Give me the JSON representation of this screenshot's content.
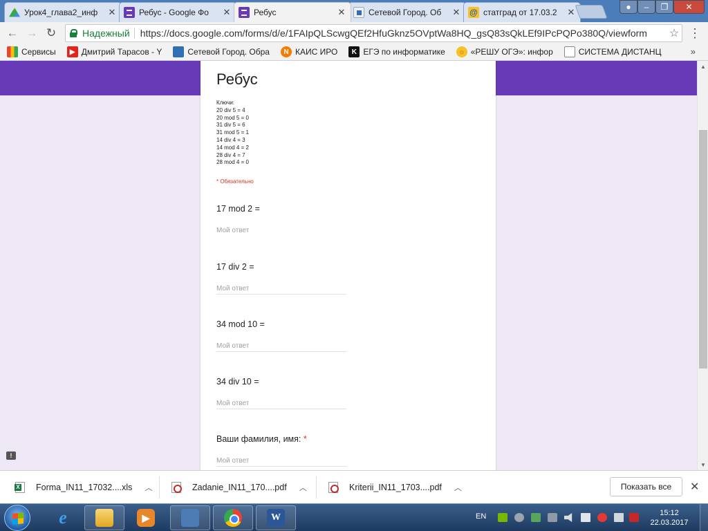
{
  "tabs": [
    {
      "title": "Урок4_глава2_инф",
      "favicon": "drive-icon",
      "active": false
    },
    {
      "title": "Ребус - Google Фо",
      "favicon": "forms-icon",
      "active": false
    },
    {
      "title": "Ребус",
      "favicon": "forms-icon",
      "active": true
    },
    {
      "title": "Сетевой Город. Об",
      "favicon": "netgorod-icon",
      "active": false
    },
    {
      "title": "статград от 17.03.2",
      "favicon": "mail-at-icon",
      "active": false
    }
  ],
  "toolbar": {
    "security_label": "Надежный",
    "url": "https://docs.google.com/forms/d/e/1FAIpQLScwgQEf2HfuGknz5OVptWa8HQ_gsQ83sQkLEf9IPcPQPo380Q/viewform"
  },
  "bookmarks": [
    {
      "label": "Сервисы",
      "icon": "apps-icon"
    },
    {
      "label": "Дмитрий Тарасов - Y",
      "icon": "youtube-icon"
    },
    {
      "label": "Сетевой Город. Обра",
      "icon": "netgorod-icon"
    },
    {
      "label": "КАИС ИРО",
      "icon": "kais-icon"
    },
    {
      "label": "ЕГЭ по информатике",
      "icon": "k-icon"
    },
    {
      "label": "«РЕШУ ОГЭ»: инфор",
      "icon": "reshu-icon"
    },
    {
      "label": "СИСТЕМА ДИСТАНЦ",
      "icon": "document-icon"
    }
  ],
  "form": {
    "title": "Ребус",
    "description_lines": [
      "Ключи:",
      "20 div 5 = 4",
      "20 mod 5 = 0",
      "31 div 5 = 6",
      "31 mod 5 = 1",
      "14 div 4 = 3",
      "14 mod 4 = 2",
      "28 div 4 = 7",
      "28 mod 4 = 0"
    ],
    "required_note": "* Обязательно",
    "answer_placeholder": "Мой ответ",
    "questions": [
      {
        "title": "17 mod 2 =",
        "required": ""
      },
      {
        "title": "17 div 2 =",
        "required": ""
      },
      {
        "title": "34 mod 10 =",
        "required": ""
      },
      {
        "title": "34 div 10 =",
        "required": ""
      },
      {
        "title": "Ваши фамилия, имя:",
        "required": "*"
      }
    ]
  },
  "downloads": {
    "items": [
      {
        "name": "Forma_IN11_17032....xls",
        "type": "xls"
      },
      {
        "name": "Zadanie_IN11_170....pdf",
        "type": "pdf"
      },
      {
        "name": "Kriterii_IN11_1703....pdf",
        "type": "pdf"
      }
    ],
    "show_all_label": "Показать все"
  },
  "taskbar": {
    "language": "EN",
    "time": "15:12",
    "date": "22.03.2017"
  },
  "colors": {
    "form_accent": "#673ab7",
    "form_background": "#ede7f6",
    "required_red": "#d93025",
    "secure_green": "#188038"
  }
}
